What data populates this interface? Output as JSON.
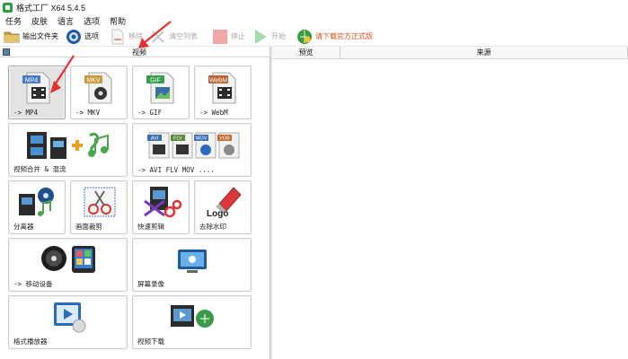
{
  "window": {
    "title": "格式工厂 X64 5.4.5"
  },
  "menu": [
    "任务",
    "皮肤",
    "语言",
    "选项",
    "帮助"
  ],
  "toolbar": {
    "output_folder": "输出文件夹",
    "options": "选项",
    "remove": "移除",
    "clear_list": "清空列表",
    "stop": "停止",
    "start": "开始",
    "official": "请下载官方正式版"
  },
  "category": {
    "label": "视频"
  },
  "list_headers": {
    "preview": "预览",
    "source": "来源"
  },
  "tiles": [
    {
      "label": "-> MP4",
      "icon": "mp4-file-icon",
      "badge": "MP4"
    },
    {
      "label": "-> MKV",
      "icon": "mkv-file-icon",
      "badge": "MKV"
    },
    {
      "label": "-> GIF",
      "icon": "gif-file-icon",
      "badge": "GIF"
    },
    {
      "label": "-> WebM",
      "icon": "webm-file-icon",
      "badge": "WebM"
    },
    {
      "label": "视频合并 & 混流",
      "icon": "video-merge-icon"
    },
    {
      "label": "-> AVI FLV MOV ....",
      "icon": "multi-format-icon",
      "badges": [
        "AVI",
        "FLV",
        "MOV",
        "VOB"
      ]
    },
    {
      "label": "分离器",
      "icon": "splitter-icon"
    },
    {
      "label": "画面裁剪",
      "icon": "crop-icon"
    },
    {
      "label": "快速剪辑",
      "icon": "quick-clip-icon"
    },
    {
      "label": "去除水印",
      "icon": "watermark-remove-icon",
      "logo_text": "Logo"
    },
    {
      "label": "-> 移动设备",
      "icon": "mobile-device-icon"
    },
    {
      "label": "屏幕录像",
      "icon": "screen-record-icon"
    },
    {
      "label": "格式播放器",
      "icon": "player-icon"
    },
    {
      "label": "视频下载",
      "icon": "video-download-icon"
    }
  ],
  "colors": {
    "accent_arrow": "#e5322d",
    "official_text": "#d4531a",
    "selected_tile": "#e3e3e3"
  }
}
